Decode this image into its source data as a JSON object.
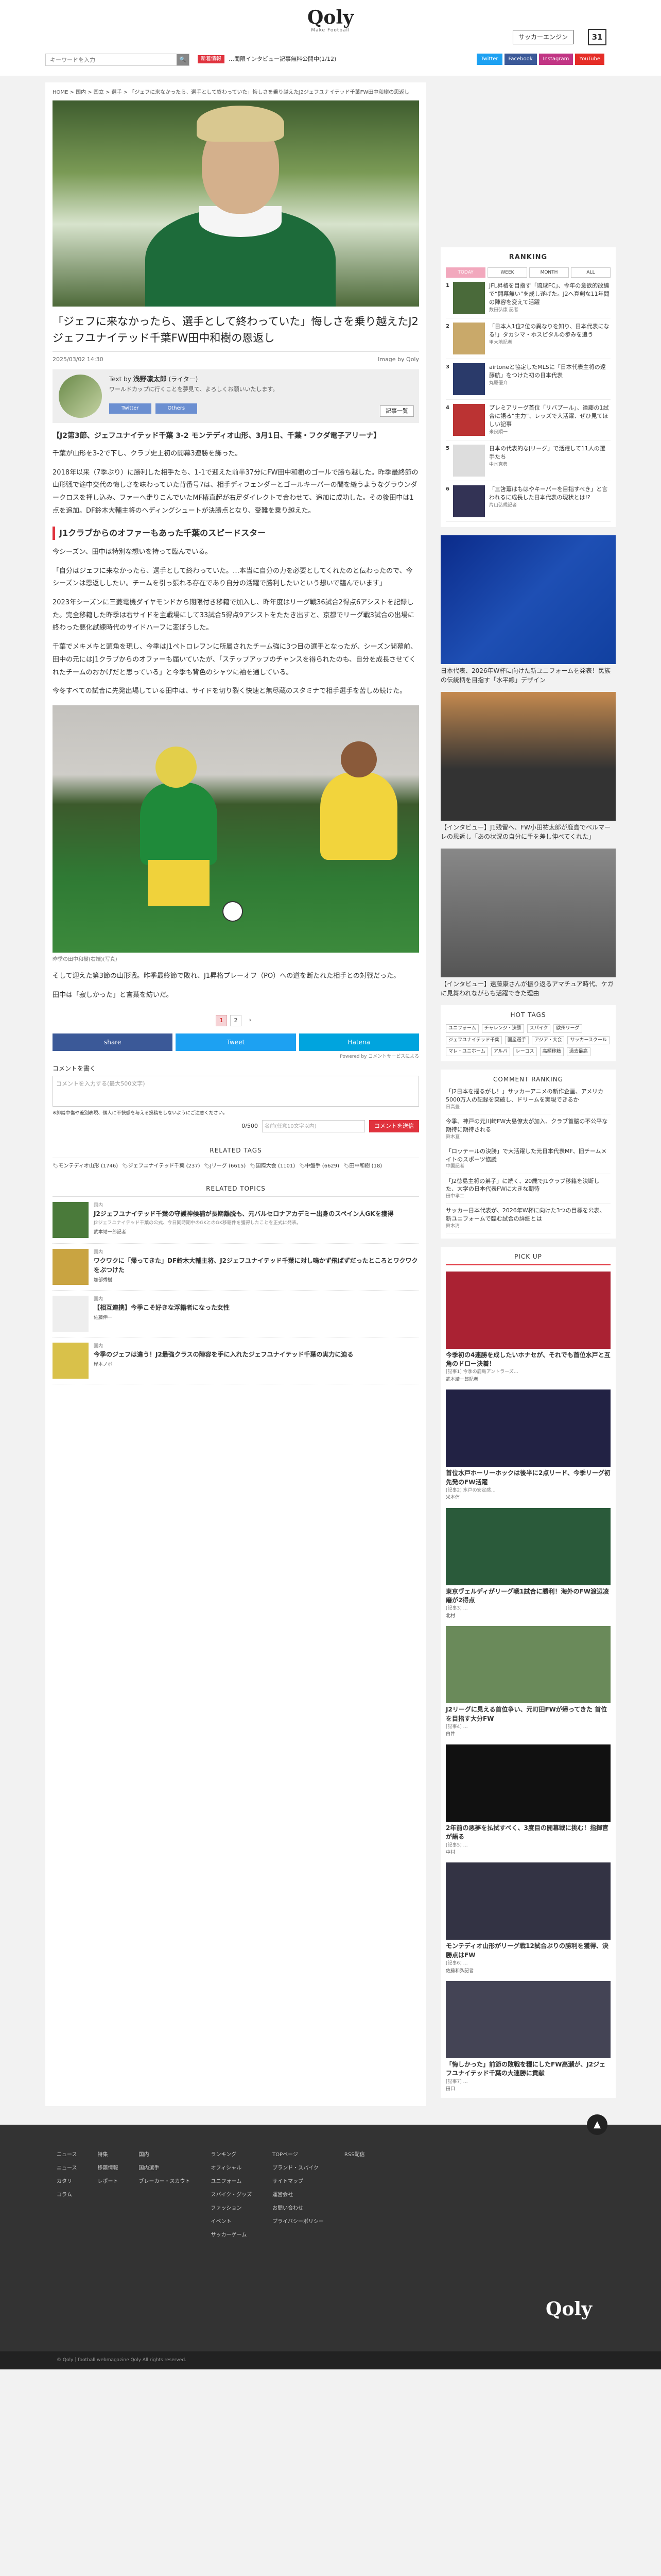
{
  "header": {
    "logo": "Qoly",
    "logo_sub": "Make Football",
    "search_placeholder": "キーワードを入力",
    "ticker_tag": "新着情報",
    "ticker_text": "…聞限インタビュー記事無料公開中(1/12)",
    "salary": "サッカーエンジン",
    "social": [
      "Twitter",
      "Facebook",
      "Instagram",
      "YouTube"
    ]
  },
  "breadcrumb": "HOME > 国内 > 国立 > 選手 > 「ジェフに来なかったら、選手として終わっていた」悔しさを乗り越えたJ2ジェフユナイテッド千葉FW田中和樹の思返し",
  "article": {
    "title": "「ジェフに来なかったら、選手として終わっていた」悔しさを乗り越えたJ2ジェフユナイテッド千葉FW田中和樹の恩返し",
    "date": "2025/03/02 14:30",
    "image_credit": "Image by Qoly",
    "author": {
      "label": "Text by",
      "name": "浅野凛太郎",
      "role": "(ライター)",
      "desc": "ワールドカップに行くことを夢見て、よろしくお願いいたします。",
      "links": [
        "Twitter",
        "Others"
      ],
      "all": "記事一覧"
    },
    "lead": "【J2第3節、ジェフユナイテッド千葉 3-2 モンテディオ山形、3月1日、千葉・フクダ電子アリーナ】",
    "p1": "千葉が山形を3-2で下し、クラブ史上初の開幕3連勝を飾った。",
    "p2": "2018年以来（7季ぶり）に勝利した相手たち、1-1で迎えた前半37分にFW田中和樹のゴールで勝ち越した。昨季最終節の山形戦で途中交代の悔しさを味わっていた背番号7は、相手ディフェンダーとゴールキーパーの間を縫うようなグラウンダークロスを押し込み、ファーへ走りこんでいたMF椿直起が右足ダイレクトで合わせて、追加に成功した。その後田中は1点を追加。DF鈴木大輔主将のヘディングシュートが決勝点となり、受難を乗り越えた。",
    "h2": "J1クラブからのオファーもあった千葉のスピードスター",
    "p3": "今シーズン、田中は特別な想いを持って臨んでいる。",
    "p4": "「自分はジェフに来なかったら、選手として終わっていた。…本当に自分の力を必要としてくれたのと伝わったので、今シーズンは恩返ししたい。チームを引っ張れる存在であり自分の活躍で勝利したいという想いで臨んでいます」",
    "p5": "2023年シーズンに三菱電機ダイヤモンドから期限付き移籍で加入し、昨年度はリーグ戦36試合2得点6アシストを記録した。完全移籍した昨季は右サイドを主戦場にして33試合5得点9アシストをたたき出すと、京都でリーグ戦3試合の出場に終わった悪化試練時代のサイドハーフに変ぼうした。",
    "p6": "千葉でメキメキと頭角を現し、今季はJ1ペトロレフンに所属されたチーム強に3つ目の選手となったが、シーズン開幕前、田中の元にはJ1クラブからのオファーも届いていたが、「ステップアップのチャンスを得られたのも、自分を成長させてくれたチームのおかげだと思っている」と今季も背色のシャツに袖を通している。",
    "p7": "今冬すべての試合に先発出場している田中は、サイドを切り裂く快速と無尽蔵のスタミナで相手選手を苦しめ続けた。",
    "photo_caption": "昨季の田中和樹(右端)(写真)",
    "p8": "そして迎えた第3節の山形戦。昨季最終節で敗れ、J1昇格プレーオフ（PO）への道を断たれた相手との対戦だった。",
    "p9": "田中は「寂しかった」と言葉を紡いだ。",
    "pages": [
      "1",
      "2",
      "›"
    ],
    "share": [
      "share",
      "Tweet",
      "Hatena"
    ],
    "powered": "Powered by コメントサービスによる"
  },
  "comments": {
    "heading": "コメントを書く",
    "placeholder": "コメントを入力する(最大500文字)",
    "note": "※誹謗中傷や差別表現、個人に不快感を与える投稿をしないようにご注意ください。",
    "count": "0/500",
    "name_placeholder": "名前(任意10文字以内)",
    "submit": "コメントを送信"
  },
  "related_tags": {
    "heading": "RELATED TAGS",
    "items": [
      "モンテディオ山形 (1746)",
      "ジェフユナイテッド千葉 (237)",
      "Jリーグ (6615)",
      "国際大会 (1101)",
      "中盤手 (6629)",
      "田中和樹 (18)"
    ]
  },
  "related_topics": {
    "heading": "RELATED TOPICS",
    "items": [
      {
        "cat": "国内",
        "title": "J2ジェフユナイテッド千葉の守護神候補が長期離脱も、元バルセロナアカデミー出身のスペイン人GKを獲得",
        "ex": "J2ジェフユナイテッド千葉の公式、今日同時期中のGKとのGK移籍件を獲得したことを正式に発表。",
        "au": "武本靖一郎記者"
      },
      {
        "cat": "国内",
        "title": "ワクワクに「帰ってきた」DF鈴木大輔主将、J2ジェフユナイテッド千葉に対し鳴かず飛ばずだったところとワクワクをぶつけた",
        "ex": "",
        "au": "加部秀樹"
      },
      {
        "cat": "国内",
        "title": "【相互連携】今季こそ好きな浮籍者になった女性",
        "ex": "",
        "au": "佐藤伸一"
      },
      {
        "cat": "国内",
        "title": "今季のジェフは違う！J2最強クラスの陣容を手に入れたジェフユナイテッド千葉の実力に迫る",
        "ex": "",
        "au": "岸本ノボ"
      }
    ]
  },
  "ranking": {
    "heading": "RANKING",
    "tabs": [
      "TODAY",
      "WEEK",
      "MONTH",
      "ALL"
    ],
    "items": [
      {
        "no": "1",
        "title": "JFL昇格を目指す「琉球FC」、今年の意欲的改編で“開幕無い”を成し遂げた。J2へ真剣な11年間の陣容を変えて活躍",
        "au": "数田弘康 記者"
      },
      {
        "no": "2",
        "title": "「日本人1位2位の異なりを知り、日本代表になる!」タカシマ・ホスピタルの歩みを追う",
        "au": "甲大地記者"
      },
      {
        "no": "3",
        "title": "airtoneと協定したMLSに「日本代表主将の遠藤航」をつけた初の日本代表",
        "au": "丸原優介"
      },
      {
        "no": "4",
        "title": "プレミアリーグ首位「リバプール」、遠藤の1試合に語る“主力”、レッズで大活躍、ぜひ見てほしい記事",
        "au": "米良順一"
      },
      {
        "no": "5",
        "title": "日本の代表的なJリーグ」で活躍して11人の選手たち",
        "au": "中水克典"
      },
      {
        "no": "6",
        "title": "「三笘薫はもはやキーパーを目指すべき」と言われるに成長した日本代表の現状とは!?",
        "au": "片山弘規記者"
      }
    ]
  },
  "ads": {
    "caption1": "日本代表、2026年W杯に向けた新ユニフォームを発表！民族の伝統柄を目指す「水平線」デザイン",
    "caption2": "【インタビュー】J1残留へ、FW小田祐太郎が鹿島でベルマーレの恩返し「あの状況の自分に手を差し伸べてくれた」",
    "caption3": "【インタビュー】遠藤康さんが振り返るアマチュア時代、ケガに見舞われながらも活躍できた理由"
  },
  "hot_tags": {
    "heading": "HOT TAGS",
    "items": [
      "ユニフォーム",
      "チャレンジ・決勝",
      "スパイク",
      "欧州リーグ",
      "ジェフユナイテッド千葉",
      "国産選手",
      "アジア・大会",
      "サッカースクール",
      "マレ・ユニホーム",
      "アルバ",
      "レーコス",
      "高額移籍",
      "過去最高"
    ]
  },
  "comment_ranking": {
    "heading": "COMMENT RANKING",
    "items": [
      {
        "title": "「J2日本を揺るがし！」サッカーアニメの新作企画、アメリカ5000万人の記録を突破し、ドリームを実現できるか",
        "au": "日高豊"
      },
      {
        "title": "今季、神戸の元川崎FW大島僚太が加入、クラブ首脳の不公平な期待に期待される",
        "au": "鈴木亘"
      },
      {
        "title": "「ロッテールの決勝」で大活躍した元日本代表MF、旧チームメイトのスポーツ協議",
        "au": "中国記者"
      },
      {
        "title": "「J2徳島主将の弟子」に続く、20歳でJ1クラブ移籍を決断した、大学の日本代表FWに大きな期待",
        "au": "田中孝二"
      },
      {
        "title": "サッカー日本代表が、2026年W杯に向けた3つの目標を公表、新ユニフォームで臨む試合の詳細とは",
        "au": "鈴木清"
      }
    ]
  },
  "pickup": {
    "heading": "PICK UP",
    "items": [
      {
        "title": "今季初の4連勝を成したいホナセが、それでも首位水戸と互角のドロー決着！",
        "d": "[記事1] 今季の鹿島アントラーズ…",
        "au": "武本靖一郎記者"
      },
      {
        "title": "首位水戸ホーリーホックは後半に2点リード、今季リーグ初先発のFW活躍",
        "d": "[記事2] 水戸の安定感…",
        "au": "米本信"
      },
      {
        "title": "東京ヴェルディがリーグ戦1試合に勝利！海外のFW渡辺凌磨が2得点",
        "d": "[記事3] …",
        "au": "北村"
      },
      {
        "title": "J2リーグに見える首位争い、元町田FWが帰ってきた 首位を目指す大分FW",
        "d": "[記事4] …",
        "au": "白井"
      },
      {
        "title": "2年前の悪夢を払拭すべく、3度目の開幕戦に挑む！指揮官が語る",
        "d": "[記事5] …",
        "au": "中村"
      },
      {
        "title": "モンテディオ山形がリーグ戦12試合ぶりの勝利を獲得、決勝点はFW",
        "d": "[記事6] …",
        "au": "佐藤和弘記者"
      },
      {
        "title": "「悔しかった」前節の敗戦を糧にしたFW高瀬が、J2ジェフユナイテッド千葉の大連勝に貢献",
        "d": "[記事7] …",
        "au": "田口"
      }
    ]
  },
  "footer": {
    "cols": [
      [
        "ニュース",
        "ニュース",
        "カタリ",
        "コラム"
      ],
      [
        "特集",
        "移籍情報",
        "レポート"
      ],
      [
        "国内",
        "国内選手",
        "ブレーカー・スカウト"
      ],
      [
        "ランキング",
        "オフィシャル",
        "ユニフォーム",
        "スパイク・グッズ",
        "ファッション",
        "イベント",
        "サッカーゲーム"
      ],
      [
        "TOPページ",
        "ブランド・スパイク",
        "サイトマップ",
        "運営会社",
        "お問い合わせ",
        "プライバシーポリシー"
      ],
      [
        "RSS配信"
      ]
    ],
    "logo": "Qoly",
    "copy": "© Qoly｜football webmagazine Qoly All rights reserved."
  }
}
